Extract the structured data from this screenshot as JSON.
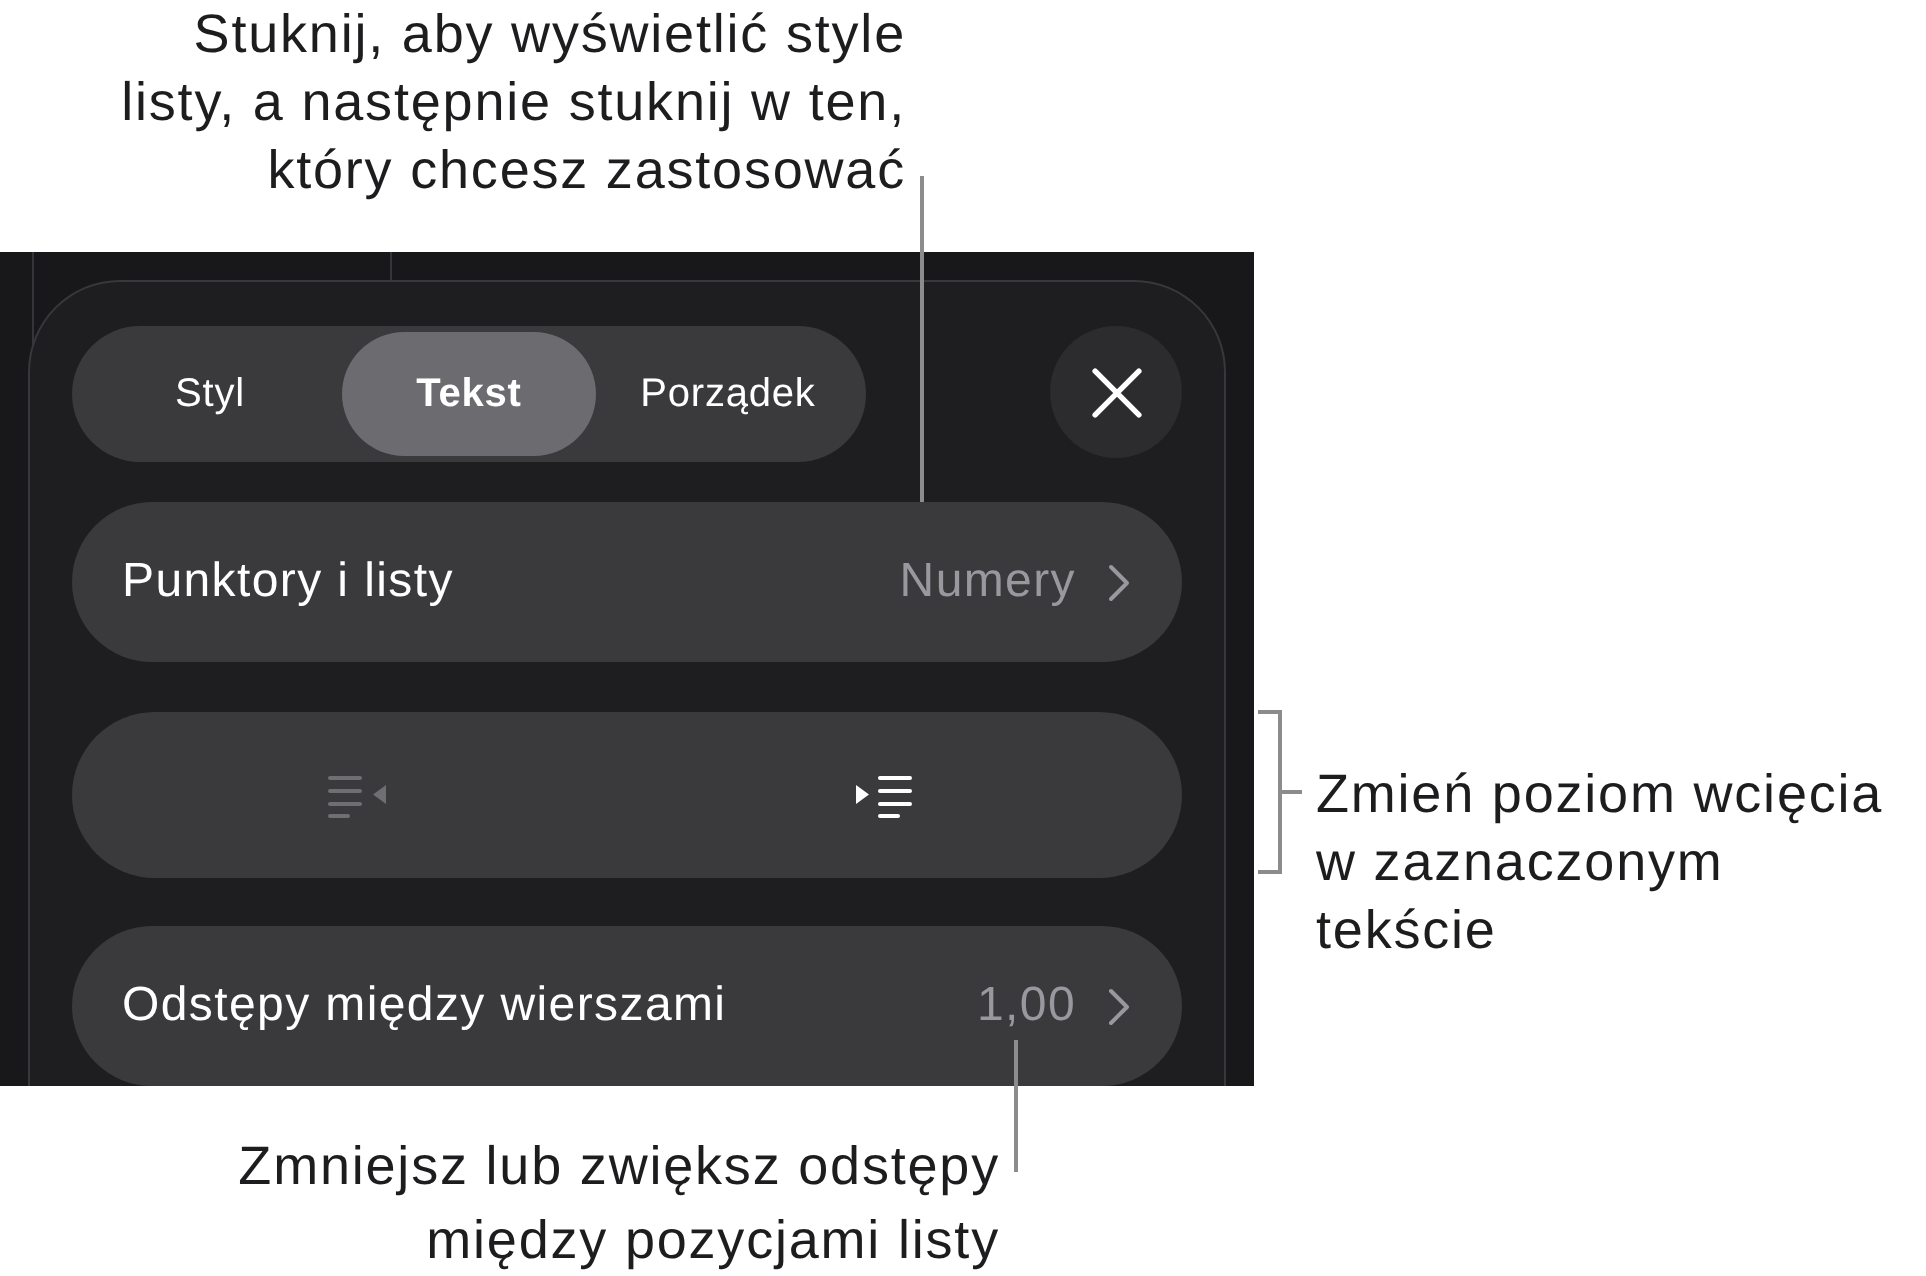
{
  "tabs": [
    {
      "label": "Styl",
      "selected": false
    },
    {
      "label": "Tekst",
      "selected": true
    },
    {
      "label": "Porządek",
      "selected": false
    }
  ],
  "rows": [
    {
      "kind": "nav",
      "label": "Punktory i listy",
      "value": "Numery"
    },
    {
      "kind": "indent",
      "buttons": [
        {
          "kind": "outdent",
          "disabled": true
        },
        {
          "kind": "indent",
          "disabled": false
        }
      ]
    },
    {
      "kind": "nav",
      "label": "Odstępy między wierszami",
      "value": "1,00"
    }
  ],
  "callouts": [
    {
      "kind": "above",
      "lines": [
        "Stuknij, aby wyświetlić style",
        "listy, a następnie stuknij w ten,",
        "który chcesz zastosować"
      ]
    },
    {
      "kind": "bracket",
      "lines": [
        "Zmień poziom wcięcia",
        "w zaznaczonym",
        "tekście"
      ]
    },
    {
      "kind": "below",
      "lines": [
        "Zmniejsz lub zwiększ odstępy",
        "między pozycjami listy"
      ]
    }
  ]
}
